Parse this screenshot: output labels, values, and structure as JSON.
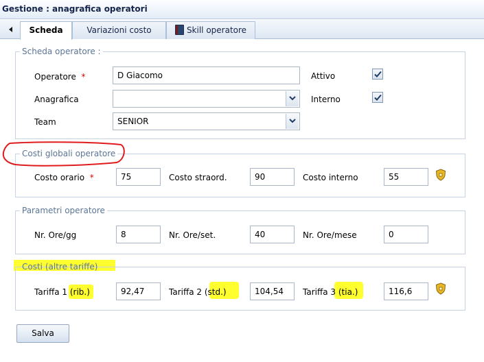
{
  "window": {
    "title": "Gestione : anagrafica operatori"
  },
  "tabs": [
    {
      "label": "Scheda"
    },
    {
      "label": "Variazioni costo"
    },
    {
      "label": "Skill operatore"
    }
  ],
  "scheda": {
    "legend": "Scheda operatore :",
    "operatore_label": "Operatore",
    "operatore_value": "D Giacomo",
    "anagrafica_label": "Anagrafica",
    "anagrafica_value": "",
    "team_label": "Team",
    "team_value": "SENIOR",
    "attivo_label": "Attivo",
    "attivo_checked": true,
    "interno_label": "Interno",
    "interno_checked": true
  },
  "costi_globali": {
    "legend": "Costi globali operatore",
    "costo_orario_label": "Costo orario",
    "costo_orario_value": "75",
    "costo_straord_label": "Costo straord.",
    "costo_straord_value": "90",
    "costo_interno_label": "Costo interno",
    "costo_interno_value": "55"
  },
  "parametri": {
    "legend": "Parametri operatore",
    "ore_gg_label": "Nr. Ore/gg",
    "ore_gg_value": "8",
    "ore_set_label": "Nr. Ore/set.",
    "ore_set_value": "40",
    "ore_mese_label": "Nr. Ore/mese",
    "ore_mese_value": "0"
  },
  "altre_tariffe": {
    "legend": "Costi (altre tariffe)",
    "tariffa1_label_a": "Tariffa 1 ",
    "tariffa1_label_b": "(rib.)",
    "tariffa1_value": "92,47",
    "tariffa2_label_a": "Tariffa 2 (",
    "tariffa2_label_b": "std.)",
    "tariffa2_value": "104,54",
    "tariffa3_label_a": "Tariffa 3 ",
    "tariffa3_label_b": "(tia.)",
    "tariffa3_value": "116,6"
  },
  "required_marker": "*",
  "save_label": "Salva",
  "colors": {
    "highlight": "#ffff1a",
    "annotation_red": "#e01b1b",
    "legend_text": "#5a7595",
    "required": "#e00000"
  }
}
